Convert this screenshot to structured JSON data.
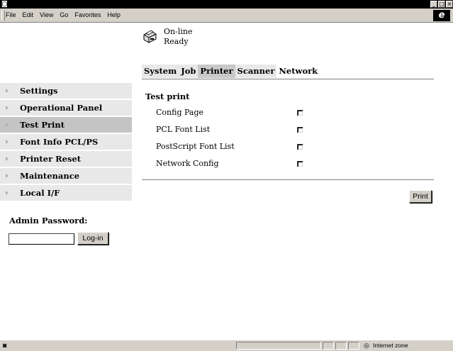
{
  "window": {
    "app_icon": "ie-page-icon",
    "minimize_glyph": "_",
    "maximize_glyph": "□",
    "close_glyph": "×"
  },
  "menubar": {
    "items": [
      "File",
      "Edit",
      "View",
      "Go",
      "Favorites",
      "Help"
    ],
    "logo": "e"
  },
  "status": {
    "line1": "On-line",
    "line2": "Ready"
  },
  "tabs": [
    {
      "label": "System"
    },
    {
      "label": "Job"
    },
    {
      "label": "Printer"
    },
    {
      "label": "Scanner"
    },
    {
      "label": "Network"
    }
  ],
  "active_tab": "Printer",
  "sidebar": {
    "items": [
      {
        "label": "Settings"
      },
      {
        "label": "Operational Panel"
      },
      {
        "label": "Test Print"
      },
      {
        "label": "Font Info PCL/PS"
      },
      {
        "label": "Printer Reset"
      },
      {
        "label": "Maintenance"
      },
      {
        "label": "Local I/F"
      }
    ],
    "active": "Test Print",
    "admin_label": "Admin Password:",
    "password_value": "",
    "login_label": "Log-in"
  },
  "main": {
    "section_title": "Test print",
    "options": [
      {
        "label": "Config Page",
        "checked": false
      },
      {
        "label": "PCL Font List",
        "checked": false
      },
      {
        "label": "PostScript Font List",
        "checked": false
      },
      {
        "label": "Network Config",
        "checked": false
      }
    ],
    "print_label": "Print"
  },
  "statusbar": {
    "zone": "Internet zone"
  },
  "colors": {
    "chrome": "#d4d0c8",
    "tab_bg": "#e8e8e8",
    "active_bg": "#c4c4c4"
  }
}
